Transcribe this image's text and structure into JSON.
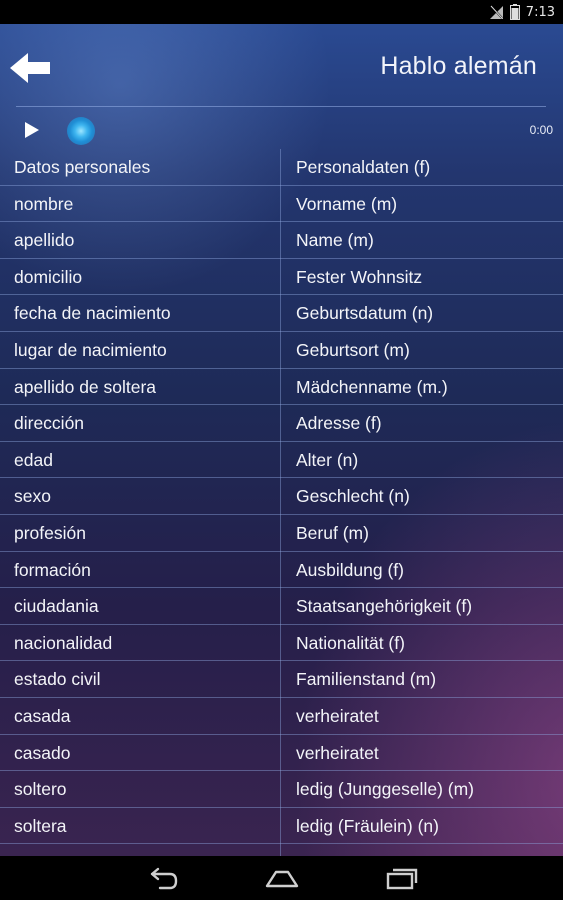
{
  "status_bar": {
    "time": "7:13",
    "icons": [
      "no-signal-icon",
      "battery-icon"
    ]
  },
  "header": {
    "back_icon": "arrow-left-icon",
    "title": "Hablo alemán"
  },
  "player": {
    "play_icon": "play-icon",
    "time": "0:00",
    "progress": 0
  },
  "rows": [
    {
      "es": "Datos personales",
      "de": "Personaldaten (f)"
    },
    {
      "es": "nombre",
      "de": "Vorname (m)"
    },
    {
      "es": "apellido",
      "de": "Name (m)"
    },
    {
      "es": "domicilio",
      "de": "Fester Wohnsitz"
    },
    {
      "es": "fecha de nacimiento",
      "de": "Geburtsdatum (n)"
    },
    {
      "es": "lugar de nacimiento",
      "de": "Geburtsort (m)"
    },
    {
      "es": "apellido de soltera",
      "de": "Mädchenname (m.)"
    },
    {
      "es": "dirección",
      "de": "Adresse (f)"
    },
    {
      "es": "edad",
      "de": "Alter (n)"
    },
    {
      "es": "sexo",
      "de": "Geschlecht (n)"
    },
    {
      "es": "profesión",
      "de": "Beruf (m)"
    },
    {
      "es": "formación",
      "de": "Ausbildung (f)"
    },
    {
      "es": "ciudadania",
      "de": "Staatsangehörigkeit (f)"
    },
    {
      "es": "nacionalidad",
      "de": "Nationalität (f)"
    },
    {
      "es": "estado civil",
      "de": "Familienstand (m)"
    },
    {
      "es": "casada",
      "de": "verheiratet"
    },
    {
      "es": "casado",
      "de": "verheiratet"
    },
    {
      "es": "soltero",
      "de": "ledig (Junggeselle) (m)"
    },
    {
      "es": "soltera",
      "de": "ledig (Fräulein) (n)"
    }
  ],
  "nav_bar": {
    "back_icon": "nav-back-icon",
    "home_icon": "nav-home-icon",
    "recents_icon": "nav-recents-icon"
  }
}
